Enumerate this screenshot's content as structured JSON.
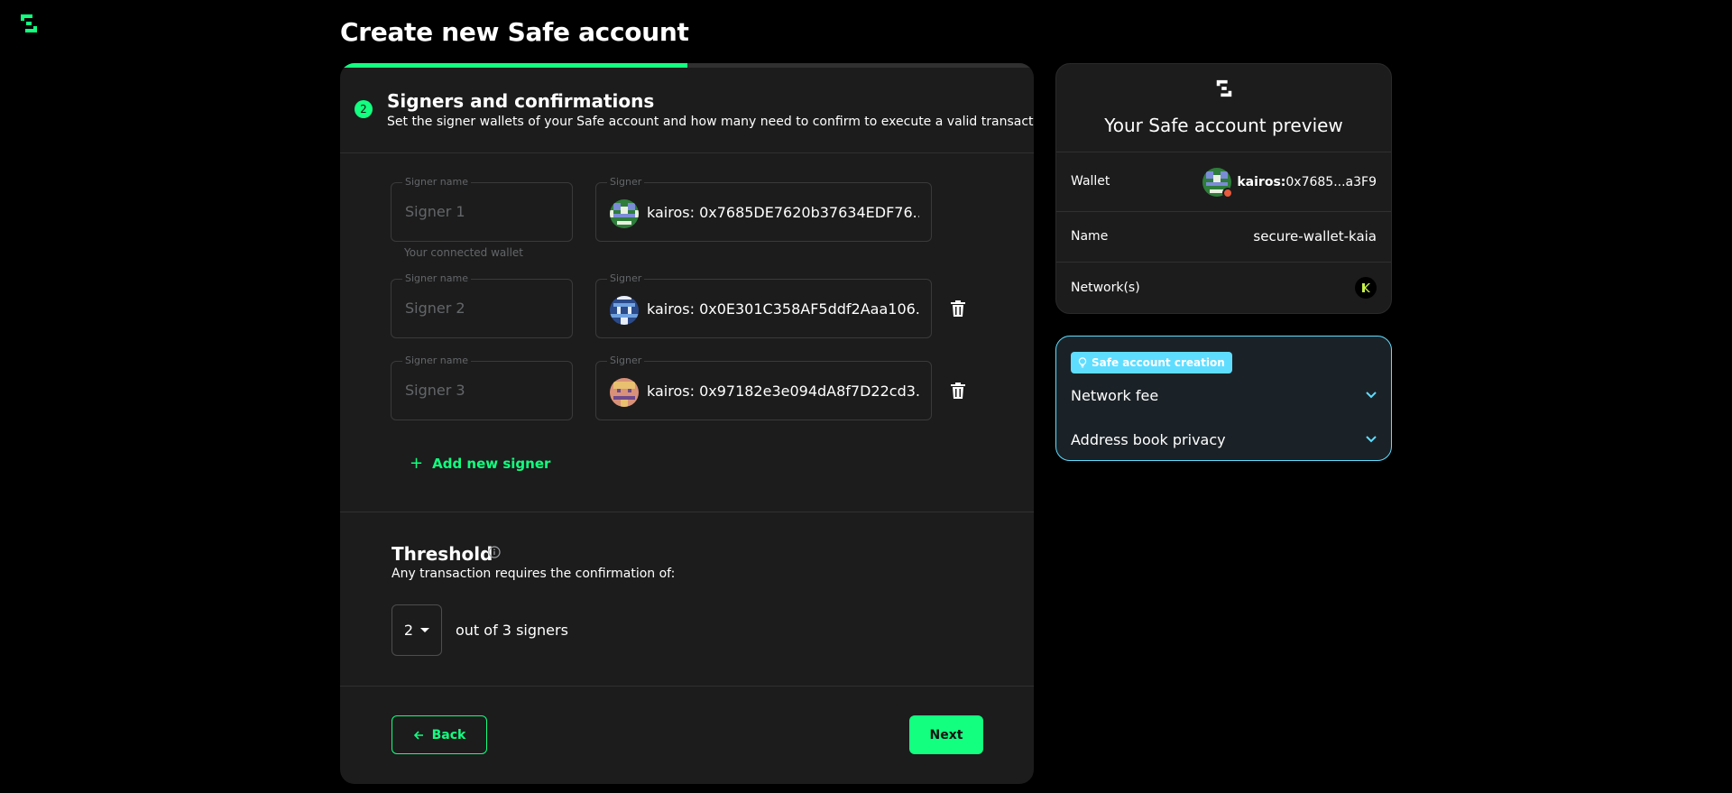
{
  "page": {
    "title": "Create new Safe account"
  },
  "step": {
    "number": "2",
    "title": "Signers and confirmations",
    "description": "Set the signer wallets of your Safe account and how many need to confirm to execute a valid transaction.",
    "progress_fraction": 0.5
  },
  "signers": [
    {
      "name_label": "Signer name",
      "name_placeholder": "Signer 1",
      "address_label": "Signer",
      "address": "kairos: 0x7685DE7620b37634EDF76...",
      "helper": "Your connected wallet",
      "deletable": false
    },
    {
      "name_label": "Signer name",
      "name_placeholder": "Signer 2",
      "address_label": "Signer",
      "address": "kairos: 0x0E301C358AF5ddf2Aaa106...",
      "deletable": true
    },
    {
      "name_label": "Signer name",
      "name_placeholder": "Signer 3",
      "address_label": "Signer",
      "address": "kairos: 0x97182e3e094dA8f7D22cd3...",
      "deletable": true
    }
  ],
  "add_signer": {
    "label": "Add new signer",
    "icon": "plus-icon"
  },
  "threshold": {
    "title": "Threshold",
    "description": "Any transaction requires the confirmation of:",
    "selected": "2",
    "out_of_text": "out of 3 signers"
  },
  "buttons": {
    "back": "Back",
    "next": "Next"
  },
  "preview": {
    "title": "Your Safe account preview",
    "wallet_label": "Wallet",
    "wallet_prefix": "kairos:",
    "wallet_address": "0x7685...a3F9",
    "name_label": "Name",
    "name_value": "secure-wallet-kaia",
    "networks_label": "Network(s)"
  },
  "hint": {
    "tag": "Safe account creation",
    "items": [
      "Network fee",
      "Address book privacy"
    ]
  },
  "colors": {
    "accent": "#12ff80",
    "info": "#5fddff",
    "card_bg": "#1c1c1c",
    "page_bg": "#000000"
  }
}
